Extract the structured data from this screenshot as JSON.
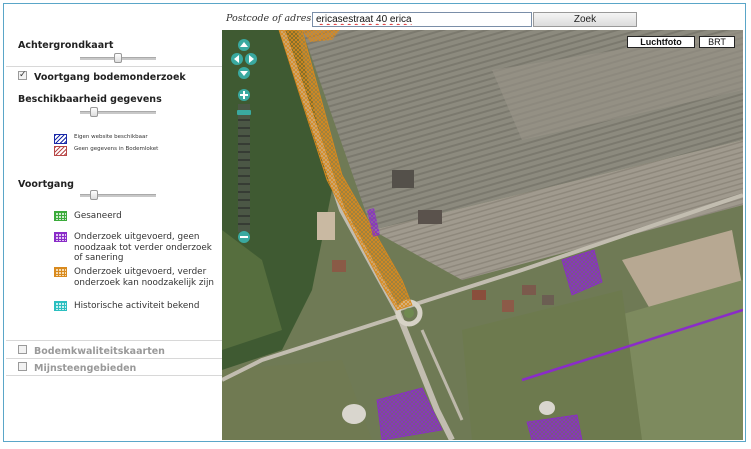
{
  "search": {
    "label": "Postcode of adres",
    "value": "ericasestraat 40 erica",
    "button": "Zoek"
  },
  "panel": {
    "achtergrond": "Achtergrondkaart",
    "voortgang_bodem": "Voortgang bodemonderzoek",
    "beschikbaarheid": "Beschikbaarheid gegevens",
    "beschik_legend": [
      {
        "text": "Eigen website beschikbaar",
        "color": "#1a2aa8"
      },
      {
        "text": "Geen gegevens in Bodemloket",
        "color": "#b84848"
      }
    ],
    "voortgang": "Voortgang",
    "voortgang_legend": [
      {
        "text": "Gesaneerd",
        "color": "#3bab3b"
      },
      {
        "text": "Onderzoek uitgevoerd, geen noodzaak tot verder onderzoek of sanering",
        "color": "#8a2cc8"
      },
      {
        "text": "Onderzoek uitgevoerd, verder onderzoek kan noodzakelijk zijn",
        "color": "#d98a1e"
      },
      {
        "text": "Historische activiteit bekend",
        "color": "#2bbfc0"
      }
    ],
    "bodemkwaliteit": "Bodemkwaliteitskaarten",
    "mijnsteen": "Mijnsteengebieden"
  },
  "map": {
    "luchtfoto": "Luchtfoto",
    "brt": "BRT"
  },
  "colors": {
    "accent": "#5aa6c8",
    "nav": "#3aa9a0"
  }
}
